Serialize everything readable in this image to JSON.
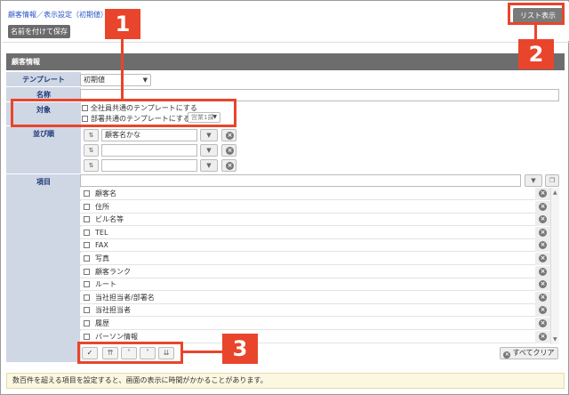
{
  "header": {
    "breadcrumb": "顧客情報／表示設定（初期値）",
    "save_label": "名前を付けて保存",
    "list_label": "リスト表示"
  },
  "section_title": "顧客情報",
  "labels": {
    "template": "テンプレート",
    "name": "名称",
    "target": "対象",
    "sort": "並び順",
    "items": "項目"
  },
  "template_value": "初期値",
  "target_options": {
    "all": "全社員共通のテンプレートにする",
    "dept": "部署共通のテンプレートにする",
    "dept_select": "営業1課"
  },
  "sort_rows": [
    "顧客名かな",
    "",
    ""
  ],
  "item_list": [
    "顧客名",
    "住所",
    "ビル名等",
    "TEL",
    "FAX",
    "写真",
    "顧客ランク",
    "ルート",
    "当社担当者/部署名",
    "当社担当者",
    "履歴",
    "パーソン情報"
  ],
  "clear_label": "すべてクリア",
  "notice": "数百件を超える項目を設定すると、画面の表示に時間がかかることがあります。",
  "callouts": [
    "1",
    "2",
    "3"
  ],
  "colors": {
    "accent": "#e8452c",
    "label_bg": "#cfd6e4",
    "section_bg": "#6d6d6d"
  }
}
